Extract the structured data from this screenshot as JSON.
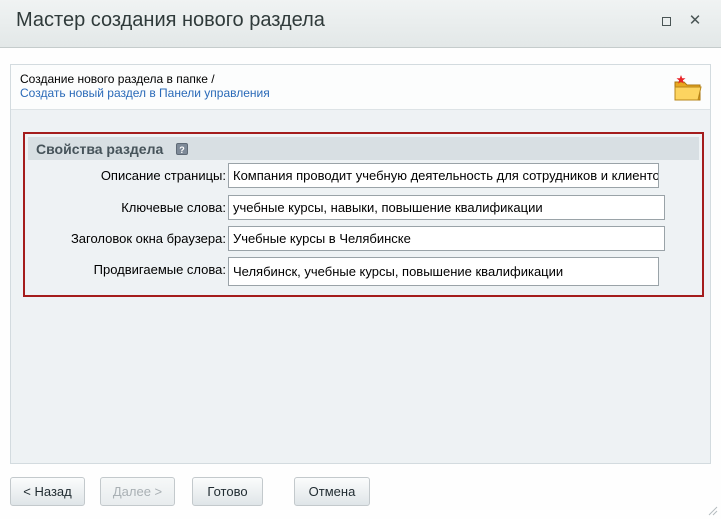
{
  "window": {
    "title": "Мастер создания нового раздела",
    "maximize_icon": "maximize-icon",
    "close_icon": "close-icon",
    "close_glyph": "✕"
  },
  "header": {
    "line1": "Создание нового раздела в папке /",
    "line2": "Создать новый раздел в Панели управления",
    "icon": "folder-new-icon"
  },
  "section": {
    "title": "Свойства раздела",
    "help_icon": "help-icon",
    "help_glyph": "?",
    "accent_color": "#a41c1c"
  },
  "fields": [
    {
      "label": "Описание страницы:",
      "value": "Компания проводит учебную деятельность для сотрудников и клиентов"
    },
    {
      "label": "Ключевые слова:",
      "value": "учебные курсы, навыки, повышение квалификации"
    },
    {
      "label": "Заголовок окна браузера:",
      "value": "Учебные курсы в Челябинске"
    },
    {
      "label": "Продвигаемые слова:",
      "value": "Челябинск, учебные курсы, повышение квалификации"
    }
  ],
  "buttons": {
    "back": "< Назад",
    "next": "Далее >",
    "done": "Готово",
    "cancel": "Отмена"
  }
}
